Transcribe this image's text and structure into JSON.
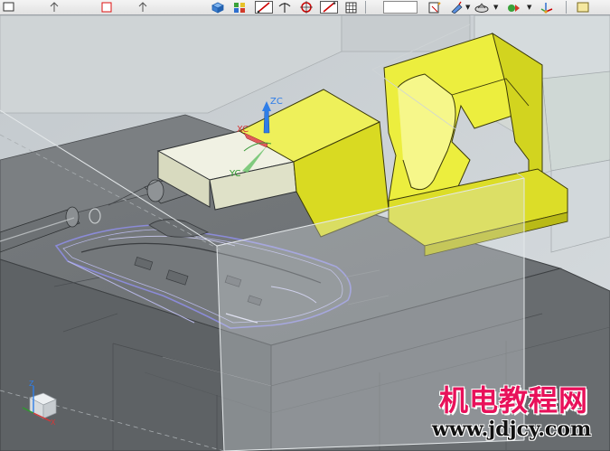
{
  "toolbar": {
    "icons": [
      "box-icon",
      "snap-icon",
      "line-icon",
      "trim-icon",
      "circle-icon",
      "line-icon",
      "grid-icon",
      "layer-icon",
      "edit-icon",
      "view-icon",
      "render-icon",
      "wcs-icon"
    ]
  },
  "viewport": {
    "wcs_labels": {
      "zc": "ZC",
      "xc": "XC",
      "yc": "YC"
    },
    "triad_labels": {
      "z": "Z",
      "x": "X"
    },
    "colors": {
      "background": "#c9cfd3",
      "mold_plate": "#6e7275",
      "insert_yellow": "#e4e629",
      "block_white": "#eef0dc",
      "part_outline": "#8b8bd8",
      "transparent_box": "#d8dde2"
    }
  },
  "watermark": {
    "title": "机电教程网",
    "url": "www.jdjcy.com"
  }
}
